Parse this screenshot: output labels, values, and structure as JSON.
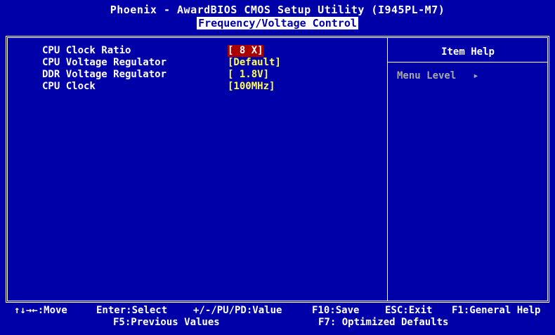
{
  "header": {
    "title": "Phoenix - AwardBIOS CMOS Setup Utility (I945PL-M7)",
    "subtitle": "Frequency/Voltage Control"
  },
  "settings": [
    {
      "label": "CPU Clock Ratio",
      "value": "[ 8 X]",
      "selected": true
    },
    {
      "label": "CPU Voltage Regulator",
      "value": "[Default]",
      "selected": false
    },
    {
      "label": "DDR Voltage Regulator",
      "value": "[ 1.8V]",
      "selected": false
    },
    {
      "label": "CPU Clock",
      "value": "[100MHz]",
      "selected": false
    }
  ],
  "help": {
    "title": "Item Help",
    "menu_level_label": "Menu Level",
    "menu_level_arrow": "▸"
  },
  "footer": {
    "move": "↑↓→←:Move",
    "enter": "Enter:Select",
    "value": "+/-/PU/PD:Value",
    "save": "F10:Save",
    "exit": "ESC:Exit",
    "help": "F1:General Help",
    "prev": "F5:Previous Values",
    "optimized": "F7: Optimized Defaults"
  },
  "colors": {
    "background": "#0000a8",
    "value": "#ffff54",
    "selected_bg": "#a80000",
    "dim": "#a8a8a8"
  }
}
